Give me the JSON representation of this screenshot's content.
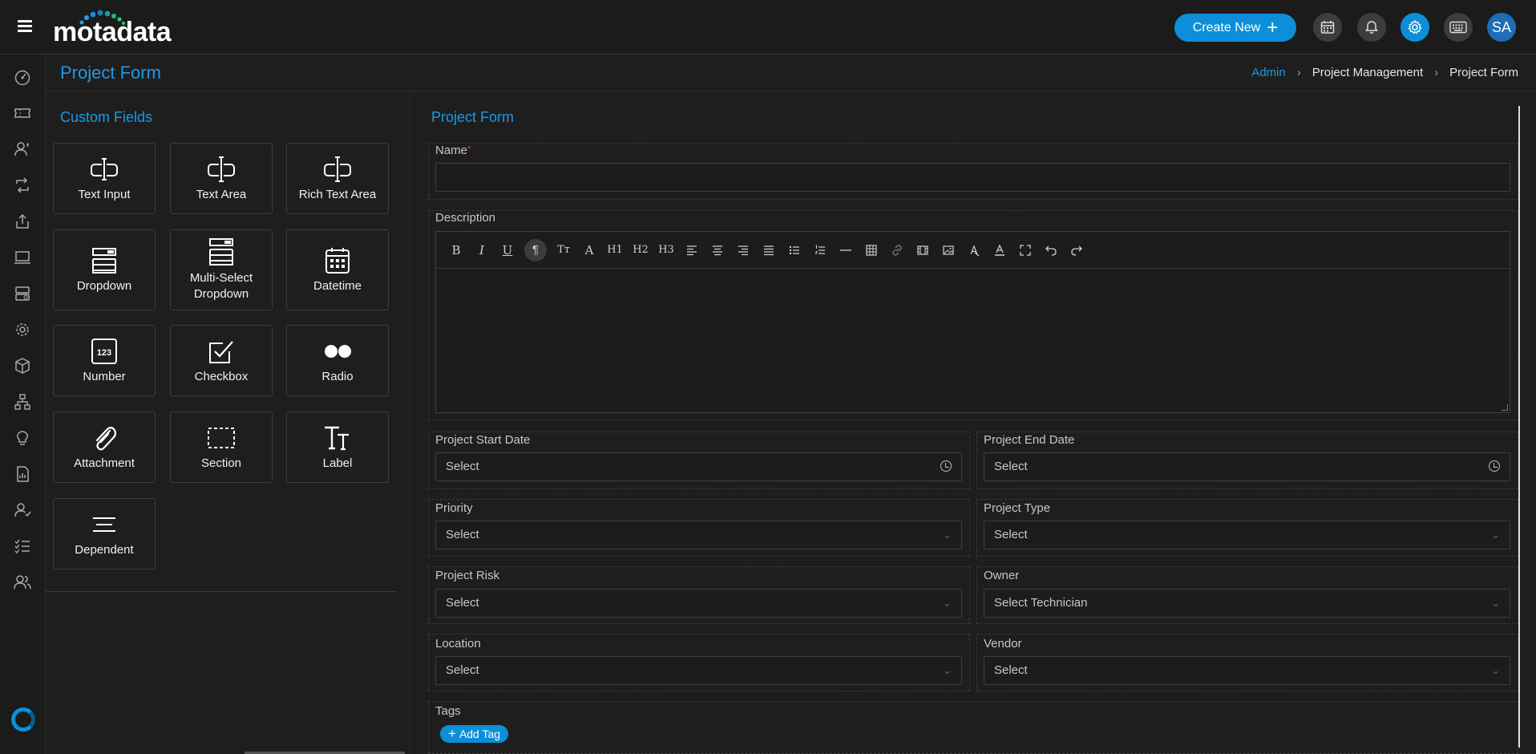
{
  "app": {
    "logo": "motadata"
  },
  "header": {
    "create_new_label": "Create New",
    "avatar_initials": "SA",
    "accent_color": "#0c8fd8"
  },
  "page": {
    "title": "Project Form",
    "breadcrumb": [
      "Admin",
      "Project Management",
      "Project Form"
    ]
  },
  "custom_fields": {
    "title": "Custom Fields",
    "tiles": [
      {
        "label": "Text Input",
        "icon": "text-input-icon"
      },
      {
        "label": "Text Area",
        "icon": "text-area-icon"
      },
      {
        "label": "Rich Text Area",
        "icon": "rich-text-area-icon"
      },
      {
        "label": "Dropdown",
        "icon": "dropdown-icon"
      },
      {
        "label": "Multi-Select Dropdown",
        "icon": "multi-select-icon"
      },
      {
        "label": "Datetime",
        "icon": "calendar-icon"
      },
      {
        "label": "Number",
        "icon": "number-icon",
        "icon_text": "123"
      },
      {
        "label": "Checkbox",
        "icon": "checkbox-icon"
      },
      {
        "label": "Radio",
        "icon": "radio-icon"
      },
      {
        "label": "Attachment",
        "icon": "paperclip-icon"
      },
      {
        "label": "Section",
        "icon": "section-icon"
      },
      {
        "label": "Label",
        "icon": "label-icon",
        "icon_text": "Tт"
      },
      {
        "label": "Dependent",
        "icon": "dependent-icon"
      }
    ]
  },
  "form": {
    "title": "Project Form",
    "name": {
      "label": "Name",
      "required_mark": "*",
      "value": ""
    },
    "description": {
      "label": "Description",
      "toolbar_text": {
        "h1": "H1",
        "h2": "H2",
        "h3": "H3",
        "tt": "Tт",
        "a": "A"
      }
    },
    "fields": {
      "project_start_date": {
        "label": "Project Start Date",
        "value": "Select"
      },
      "project_end_date": {
        "label": "Project End Date",
        "value": "Select"
      },
      "priority": {
        "label": "Priority",
        "value": "Select"
      },
      "project_type": {
        "label": "Project Type",
        "value": "Select"
      },
      "project_risk": {
        "label": "Project Risk",
        "value": "Select"
      },
      "owner": {
        "label": "Owner",
        "value": "Select Technician"
      },
      "location": {
        "label": "Location",
        "value": "Select"
      },
      "vendor": {
        "label": "Vendor",
        "value": "Select"
      }
    },
    "tags": {
      "label": "Tags",
      "add_label": "Add Tag"
    }
  }
}
